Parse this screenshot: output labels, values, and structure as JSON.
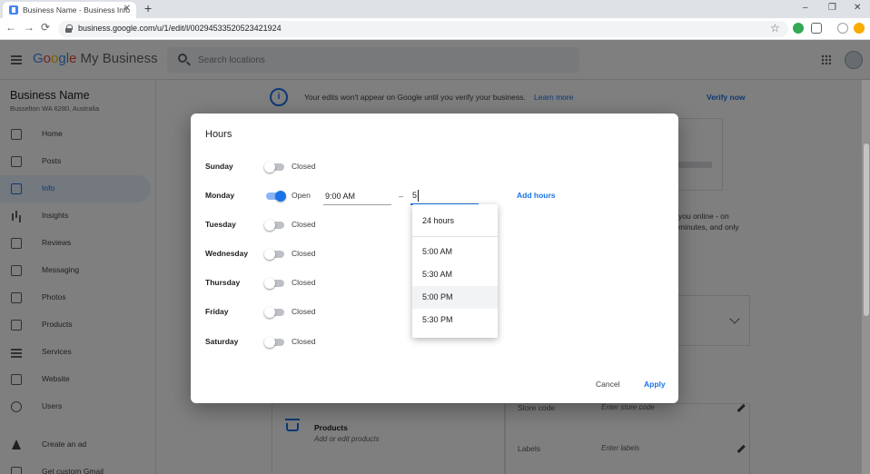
{
  "browser": {
    "tab_title": "Business Name - Business Info",
    "tab_close": "✕",
    "new_tab": "+",
    "url": "business.google.com/u/1/edit/l/00294533520523421924",
    "window_controls": [
      "–",
      "❐",
      "✕"
    ],
    "nav": [
      "←",
      "→",
      "⟳"
    ],
    "star": "☆",
    "menu": "⋮"
  },
  "app": {
    "logo_parts": [
      "G",
      "o",
      "o",
      "g",
      "l",
      "e"
    ],
    "logo_suffix": " My Business",
    "search_placeholder": "Search locations"
  },
  "sidebar": {
    "business_name": "Business Name",
    "address": "Busselton WA 6280, Australia",
    "items": [
      {
        "label": "Home",
        "icon": "home-icon"
      },
      {
        "label": "Posts",
        "icon": "posts-icon"
      },
      {
        "label": "Info",
        "icon": "store-icon"
      },
      {
        "label": "Insights",
        "icon": "insights-icon"
      },
      {
        "label": "Reviews",
        "icon": "reviews-icon"
      },
      {
        "label": "Messaging",
        "icon": "messaging-icon"
      },
      {
        "label": "Photos",
        "icon": "photos-icon"
      },
      {
        "label": "Products",
        "icon": "products-icon"
      },
      {
        "label": "Services",
        "icon": "services-icon"
      },
      {
        "label": "Website",
        "icon": "website-icon"
      },
      {
        "label": "Users",
        "icon": "add-user-icon"
      },
      {
        "label": "Create an ad",
        "icon": "google-ads-icon"
      },
      {
        "label": "Get custom Gmail",
        "icon": "gmail-icon"
      }
    ],
    "active_index": 2
  },
  "banner": {
    "icon": "i",
    "text": "Your edits won't appear on Google until you verify your business.",
    "link": "Learn more",
    "verify": "Verify now"
  },
  "background": {
    "snippet_1": "you online - on",
    "snippet_2": "minutes, and only",
    "products_title": "Products",
    "products_sub": "Add or edit products",
    "store_code_label": "Store code",
    "store_code_placeholder": "Enter store code",
    "labels_label": "Labels",
    "labels_placeholder": "Enter labels"
  },
  "hours_dialog": {
    "title": "Hours",
    "days": [
      {
        "day": "Sunday",
        "status": "Closed",
        "open": false
      },
      {
        "day": "Monday",
        "status": "Open",
        "open": true,
        "open_time": "9:00 AM",
        "close_time": "5",
        "add_hours": "Add hours"
      },
      {
        "day": "Tuesday",
        "status": "Closed",
        "open": false
      },
      {
        "day": "Wednesday",
        "status": "Closed",
        "open": false
      },
      {
        "day": "Thursday",
        "status": "Closed",
        "open": false
      },
      {
        "day": "Friday",
        "status": "Closed",
        "open": false
      },
      {
        "day": "Saturday",
        "status": "Closed",
        "open": false
      }
    ],
    "separator": "–",
    "cancel": "Cancel",
    "apply": "Apply",
    "dropdown": [
      "24 hours",
      "5:00 AM",
      "5:30 AM",
      "5:00 PM",
      "5:30 PM"
    ],
    "dropdown_highlight": "5:00 PM"
  },
  "colors": {
    "accent": "#1a73e8",
    "toggle_on_track": "#8ab4f8",
    "toggle_off_track": "#bdc1c6"
  }
}
